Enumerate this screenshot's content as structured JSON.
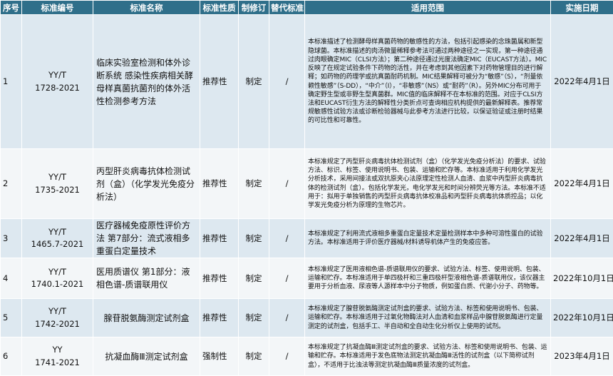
{
  "headers": {
    "seq": "序号",
    "code": "标准编号",
    "name": "标准名称",
    "nature": "标准性质",
    "revision": "制修订",
    "replace": "替代标准",
    "scope": "适用范围",
    "date": "实施日期"
  },
  "rows": [
    {
      "seq": "1",
      "code_line1": "YY/T",
      "code_line2": "1728-2021",
      "name": "临床实验室检测和体外诊断系统 感染性疾病相关酵母样真菌抗菌剂的体外活性检测参考方法",
      "nature": "推荐性",
      "revision": "制定",
      "replace": "/",
      "scope": "本标准描述了检测酵母样真菌药物的敏感性的方法，包括引起感染的念珠菌属和新型隐球菌。本标准描述的肉汤微量稀释参考法可通过两种途径之一实现，第一种途径通过肉眼确定MIC（CLSI方法）；第二种途径通过光度法确定MIC（EUCAST方法）。MIC反映了在规定试验条件下药物的活性，并在考虑到其他因素下对药物管理目的进行解释；如药物的药理学或抗真菌耐药机制。MIC结果解释可被分为“敏感”（S），“剂量依赖性敏感”（S-DD），“中介”（I），“非敏感”（NS）或“耐药”（R）。另外MIC分布可用于确定野生型或非野生型真菌群。MIC值的临床解释不在本标准的范围。对应于CLSI方法和EUCAST衍生方法的解释性分类折点可查询相应机构提供的最新解释表。推荐常规敏感性试验方法或诊断检验器械与此参考方法进行比较，以保证验证或注册时结果的可比性和可靠性。",
      "date": "2022年4月1日"
    },
    {
      "seq": "2",
      "code_line1": "YY/T",
      "code_line2": "1735-2021",
      "name": "丙型肝炎病毒抗体检测试剂（盒）（化学发光免疫分析法）",
      "nature": "推荐性",
      "revision": "制定",
      "replace": "/",
      "scope": "本标准规定了丙型肝炎病毒抗体检测试剂（盒）（化学发光免疫分析法）的要求、试验方法、标识、标签、使用说明书、包装、运输和贮存等。本标准适用于利用化学发光分析技术，采用间接法或双抗原夹心法原理定性检测人血清、血浆中丙型肝炎病毒抗体的检测试剂（盒）。包括化学发光，电化学发光和时间分辨荧光等方法。本标准不适用于：拟用于单独销售的丙型肝炎病毒抗体校准品和丙型肝炎病毒抗体质控品；以化学发光免疫分析为原理的生物芯片。",
      "date": "2022年4月1日"
    },
    {
      "seq": "3",
      "code_line1": "YY/T",
      "code_line2": "1465.7-2021",
      "name": "医疗器械免疫原性评价方法 第7部分：流式液相多重蛋白定量技术",
      "nature": "推荐性",
      "revision": "制定",
      "replace": "/",
      "scope": "本标准规定了利用流式液相多重蛋白定量技术定量检测样本中多种可溶性蛋白的试验方法。本标准适用于评价医疗器械/材料诱导机体产生的免疫应答。",
      "date": "2022年4月1日"
    },
    {
      "seq": "4",
      "code_line1": "YY/T",
      "code_line2": "1740.1-2021",
      "name": "医用质谱仪 第1部分：液相色谱-质谱联用仪",
      "nature": "推荐性",
      "revision": "制定",
      "replace": "/",
      "scope": "本标准规定了医用液相色谱-质谱联用仪的要求、试验方法、标签、使用说明、包装、运输和贮存。本标准适用于单四极杆和三重四极杆型液相色谱-质谱联用仪，该仪器主要用于分析血液、尿液等人源样本中分子物质，例如蛋白质、代谢小分子、药物等。",
      "date": "2022年10月1日"
    },
    {
      "seq": "5",
      "code_line1": "YY/T",
      "code_line2": "1742-2021",
      "name": "腺苷脱氨酶测定试剂盒",
      "nature": "推荐性",
      "revision": "制定",
      "replace": "/",
      "scope": "本标准规定了腺苷脱氨酶测定试剂盒的要求、试验方法、标签和使用说明书、包装、运输和贮存。本标准适用于过氧化物酶法对人血清和血浆样品中腺苷脱氨酶进行定量测定的试剂盒，包括手工、半自动和全自动生化分析仪上使用的试剂。",
      "date": "2022年10月1日"
    },
    {
      "seq": "6",
      "code_line1": "YY",
      "code_line2": "1741-2021",
      "name": "抗凝血酶Ⅲ测定试剂盒",
      "nature": "强制性",
      "revision": "制定",
      "replace": "/",
      "scope": "本标准规定了抗凝血酶Ⅲ测定试剂盒的要求、试验方法、标签和使用说明书、包装、运输和贮存。本标准适用于发色底物法测定抗凝血酶Ⅲ活性的试剂盒（以下简称试剂盒），不适用于比浊法等测定抗凝血酶Ⅲ质量浓度的试剂盒。",
      "date": "2023年4月1日"
    }
  ]
}
